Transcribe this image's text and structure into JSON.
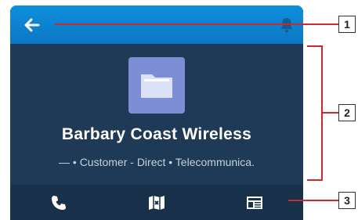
{
  "record": {
    "name": "Barbary Coast Wireless",
    "subtitle": "— • Customer - Direct • Telecommunica."
  },
  "icons": {
    "back": "back-arrow-icon",
    "notifications": "bell-icon",
    "record_type": "folder-icon",
    "call": "phone-icon",
    "map": "map-icon",
    "news": "newspaper-icon"
  },
  "callouts": [
    "1",
    "2",
    "3"
  ],
  "colors": {
    "header": "#0b86d6",
    "body": "#1e3a57",
    "action_bar": "#183049",
    "folder_tile": "#7d8ed6",
    "callout_line": "#cc2a2a"
  }
}
